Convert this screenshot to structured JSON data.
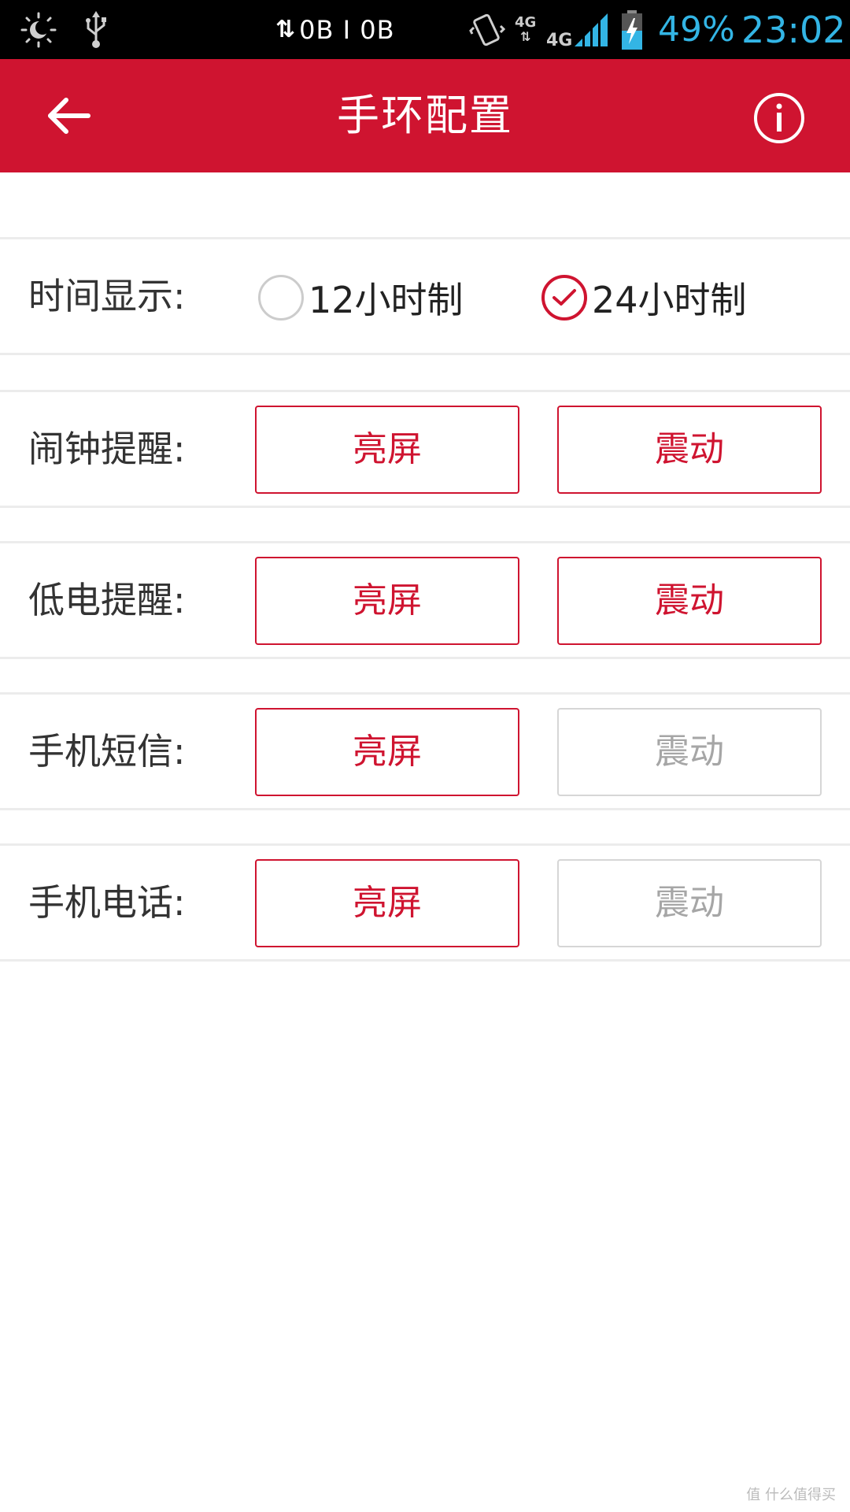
{
  "status_bar": {
    "traffic": "0B I 0B",
    "network_top": "4G",
    "network_bottom": "4G",
    "battery": "49%",
    "time": "23:02",
    "icons": [
      "brightness-icon",
      "usb-icon",
      "data-arrows-icon",
      "vibrate-icon",
      "signal-icon",
      "battery-charging-icon"
    ]
  },
  "header": {
    "title": "手环配置",
    "back_icon": "back-arrow-icon",
    "info_icon": "info-icon"
  },
  "settings": {
    "time_display": {
      "label": "时间显示:",
      "options": [
        {
          "label": "12小时制",
          "selected": false
        },
        {
          "label": "24小时制",
          "selected": true
        }
      ]
    },
    "rows": [
      {
        "label": "闹钟提醒:",
        "screen_label": "亮屏",
        "screen_on": true,
        "vibrate_label": "震动",
        "vibrate_on": true
      },
      {
        "label": "低电提醒:",
        "screen_label": "亮屏",
        "screen_on": true,
        "vibrate_label": "震动",
        "vibrate_on": true
      },
      {
        "label": "手机短信:",
        "screen_label": "亮屏",
        "screen_on": true,
        "vibrate_label": "震动",
        "vibrate_on": false
      },
      {
        "label": "手机电话:",
        "screen_label": "亮屏",
        "screen_on": true,
        "vibrate_label": "震动",
        "vibrate_on": false
      }
    ]
  },
  "watermark": "值 什么值得买",
  "colors": {
    "accent": "#cf1430",
    "status_blue": "#33b5e5",
    "inactive_border": "#d6d6d6",
    "inactive_text": "#a6a6a6"
  }
}
